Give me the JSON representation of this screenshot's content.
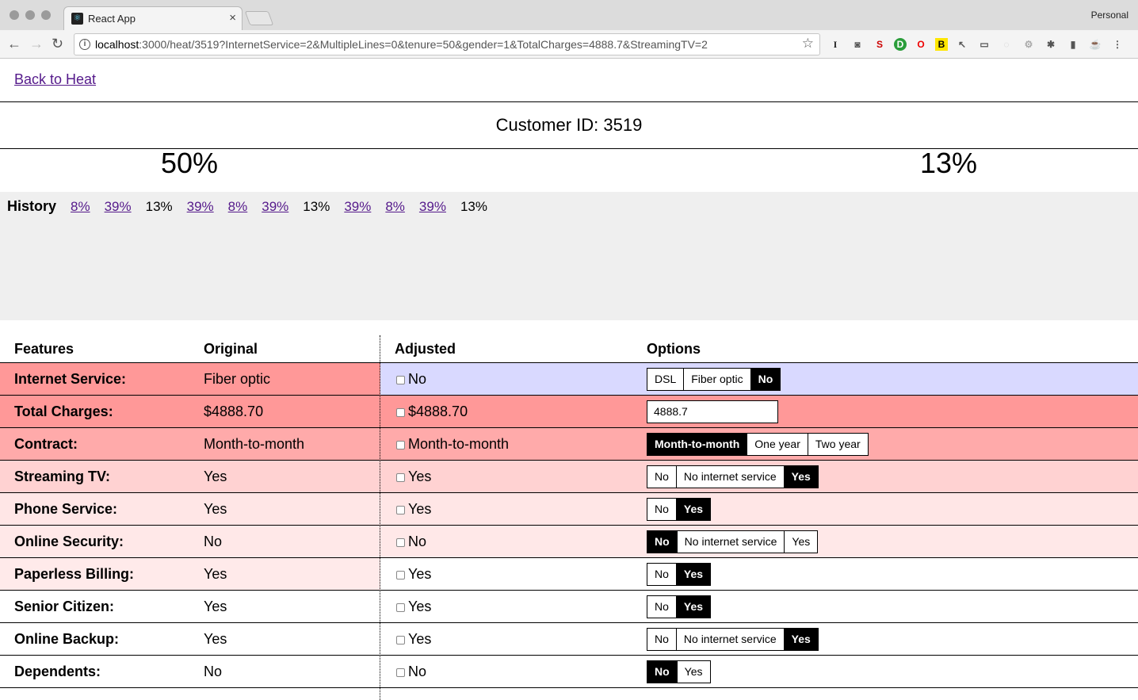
{
  "browser": {
    "tab_title": "React App",
    "profile": "Personal",
    "url_host": "localhost",
    "url_rest": ":3000/heat/3519?InternetService=2&MultipleLines=0&tenure=50&gender=1&TotalCharges=4888.7&StreamingTV=2"
  },
  "page": {
    "back_link": "Back to Heat",
    "customer_label": "Customer ID: 3519",
    "original_pct": "50%",
    "adjusted_pct": "13%"
  },
  "history": {
    "label": "History",
    "items": [
      {
        "text": "8%",
        "link": true
      },
      {
        "text": "39%",
        "link": true
      },
      {
        "text": "13%",
        "link": false
      },
      {
        "text": "39%",
        "link": true
      },
      {
        "text": "8%",
        "link": true
      },
      {
        "text": "39%",
        "link": true
      },
      {
        "text": "13%",
        "link": false
      },
      {
        "text": "39%",
        "link": true
      },
      {
        "text": "8%",
        "link": true
      },
      {
        "text": "39%",
        "link": true
      },
      {
        "text": "13%",
        "link": false
      }
    ]
  },
  "table": {
    "headers": {
      "features": "Features",
      "original": "Original",
      "adjusted": "Adjusted",
      "options": "Options"
    },
    "rows": [
      {
        "feature": "Internet Service:",
        "original": "Fiber optic",
        "adjusted": "No",
        "bg": "#ff9898",
        "adj_bg": "#d9d9ff",
        "options": [
          "DSL",
          "Fiber optic",
          "No"
        ],
        "selected": 2
      },
      {
        "feature": "Total Charges:",
        "original": "$4888.70",
        "adjusted": "$4888.70",
        "bg": "#ff9898",
        "adj_bg": "#ff9898",
        "input_value": "4888.7"
      },
      {
        "feature": "Contract:",
        "original": "Month-to-month",
        "adjusted": "Month-to-month",
        "bg": "#ffaaaa",
        "adj_bg": "#ffaaaa",
        "options": [
          "Month-to-month",
          "One year",
          "Two year"
        ],
        "selected": 0
      },
      {
        "feature": "Streaming TV:",
        "original": "Yes",
        "adjusted": "Yes",
        "bg": "#ffd2d2",
        "adj_bg": "#ffd2d2",
        "options": [
          "No",
          "No internet service",
          "Yes"
        ],
        "selected": 2
      },
      {
        "feature": "Phone Service:",
        "original": "Yes",
        "adjusted": "Yes",
        "bg": "#ffe6e6",
        "adj_bg": "#ffe6e6",
        "options": [
          "No",
          "Yes"
        ],
        "selected": 1
      },
      {
        "feature": "Online Security:",
        "original": "No",
        "adjusted": "No",
        "bg": "#ffe8e8",
        "adj_bg": "#ffe8e8",
        "options": [
          "No",
          "No internet service",
          "Yes"
        ],
        "selected": 0
      },
      {
        "feature": "Paperless Billing:",
        "original": "Yes",
        "adjusted": "Yes",
        "bg": "#ffeaea",
        "adj_bg": "#ffffff",
        "options": [
          "No",
          "Yes"
        ],
        "selected": 1
      },
      {
        "feature": "Senior Citizen:",
        "original": "Yes",
        "adjusted": "Yes",
        "bg": "#ffffff",
        "adj_bg": "#ffffff",
        "options": [
          "No",
          "Yes"
        ],
        "selected": 1
      },
      {
        "feature": "Online Backup:",
        "original": "Yes",
        "adjusted": "Yes",
        "bg": "#ffffff",
        "adj_bg": "#ffffff",
        "options": [
          "No",
          "No internet service",
          "Yes"
        ],
        "selected": 2
      },
      {
        "feature": "Dependents:",
        "original": "No",
        "adjusted": "No",
        "bg": "#ffffff",
        "adj_bg": "#ffffff",
        "options": [
          "No",
          "Yes"
        ],
        "selected": 0
      }
    ]
  }
}
